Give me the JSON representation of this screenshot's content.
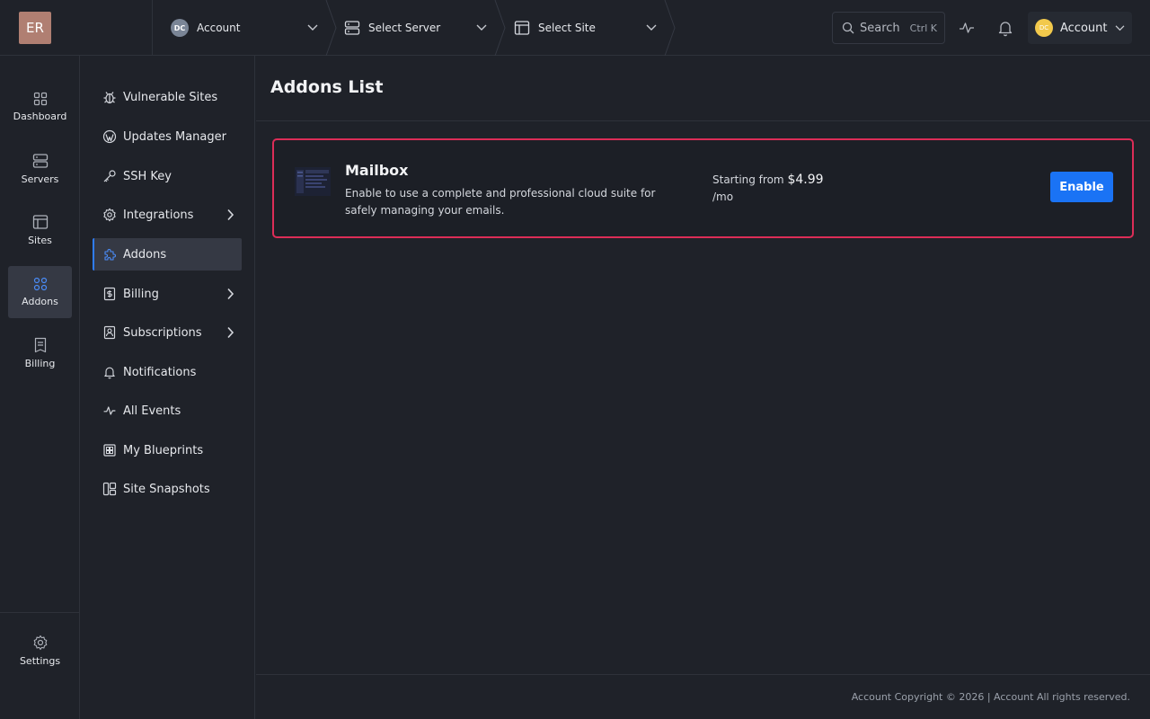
{
  "logo": {
    "text": "ER"
  },
  "breadcrumbs": {
    "account": {
      "avatar": "DC",
      "label": "Account"
    },
    "server": {
      "label": "Select Server"
    },
    "site": {
      "label": "Select Site"
    }
  },
  "search": {
    "label": "Search",
    "shortcut": "Ctrl K"
  },
  "user_menu": {
    "avatar": "DC",
    "label": "Account"
  },
  "rail": {
    "items": [
      {
        "label": "Dashboard",
        "icon": "grid-icon"
      },
      {
        "label": "Servers",
        "icon": "server-icon"
      },
      {
        "label": "Sites",
        "icon": "browser-icon"
      },
      {
        "label": "Addons",
        "icon": "addons-icon",
        "active": true
      },
      {
        "label": "Billing",
        "icon": "receipt-icon"
      }
    ],
    "settings": {
      "label": "Settings",
      "icon": "gear-icon"
    }
  },
  "subnav": {
    "items": [
      {
        "label": "Vulnerable Sites",
        "icon": "bug-icon"
      },
      {
        "label": "Updates Manager",
        "icon": "wordpress-icon"
      },
      {
        "label": "SSH Key",
        "icon": "key-icon"
      },
      {
        "label": "Integrations",
        "icon": "gear-icon",
        "has_children": true
      },
      {
        "label": "Addons",
        "icon": "puzzle-icon",
        "active": true
      },
      {
        "label": "Billing",
        "icon": "invoice-icon",
        "has_children": true
      },
      {
        "label": "Subscriptions",
        "icon": "subscription-icon",
        "has_children": true
      },
      {
        "label": "Notifications",
        "icon": "bell-icon"
      },
      {
        "label": "All Events",
        "icon": "activity-icon"
      },
      {
        "label": "My Blueprints",
        "icon": "blueprint-icon"
      },
      {
        "label": "Site Snapshots",
        "icon": "snapshot-icon"
      }
    ]
  },
  "main": {
    "title": "Addons List",
    "addons": [
      {
        "name": "Mailbox",
        "description": "Enable to use a complete and professional cloud suite for safely managing your emails.",
        "price_prefix": "Starting from",
        "price": "$4.99",
        "period": "/mo",
        "action": "Enable"
      }
    ]
  },
  "footer": {
    "text": "Account Copyright © 2026 | Account All rights reserved."
  },
  "colors": {
    "accent": "#1a73f5",
    "highlight_border": "#dc2d57",
    "background": "#1f2229"
  }
}
